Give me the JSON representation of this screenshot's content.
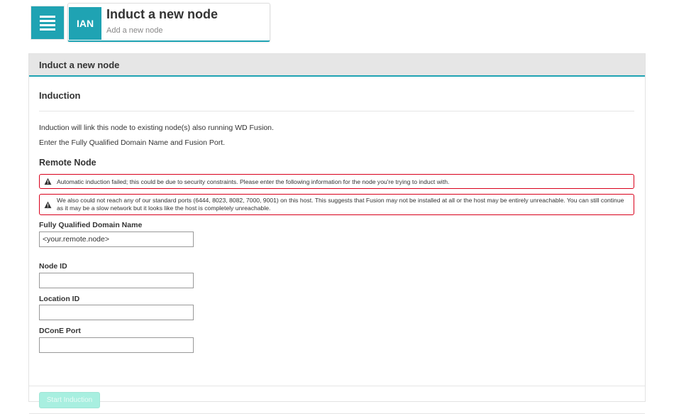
{
  "header": {
    "menu_icon": "hamburger-menu-icon",
    "badge": "IAN",
    "title": "Induct a new node",
    "subtitle": "Add a new node"
  },
  "panel": {
    "heading": "Induct a new node",
    "section_title": "Induction",
    "description_1": "Induction will link this node to existing node(s) also running WD Fusion.",
    "description_2": "Enter the Fully Qualified Domain Name and Fusion Port.",
    "remote_title": "Remote Node",
    "alerts": [
      {
        "icon": "warning-icon",
        "text": "Automatic induction failed; this could be due to security constraints. Please enter the following information for the node you're trying to induct with."
      },
      {
        "icon": "warning-icon",
        "text": "We also could not reach any of our standard ports (6444, 8023, 8082, 7000, 9001) on this host. This suggests that Fusion may not be installed at all or the host may be entirely unreachable. You can still continue as it may be a slow network but it looks like the host is completely unreachable."
      }
    ],
    "fields": {
      "fqdn": {
        "label": "Fully Qualified Domain Name",
        "value": "<your.remote.node>"
      },
      "node_id": {
        "label": "Node ID",
        "value": ""
      },
      "location_id": {
        "label": "Location ID",
        "value": ""
      },
      "dcone_port": {
        "label": "DConE Port",
        "value": ""
      }
    },
    "start_button": "Start Induction"
  },
  "colors": {
    "accent": "#1fa3b3",
    "alert_border": "#d9001b",
    "button_disabled": "#a8efe0"
  }
}
